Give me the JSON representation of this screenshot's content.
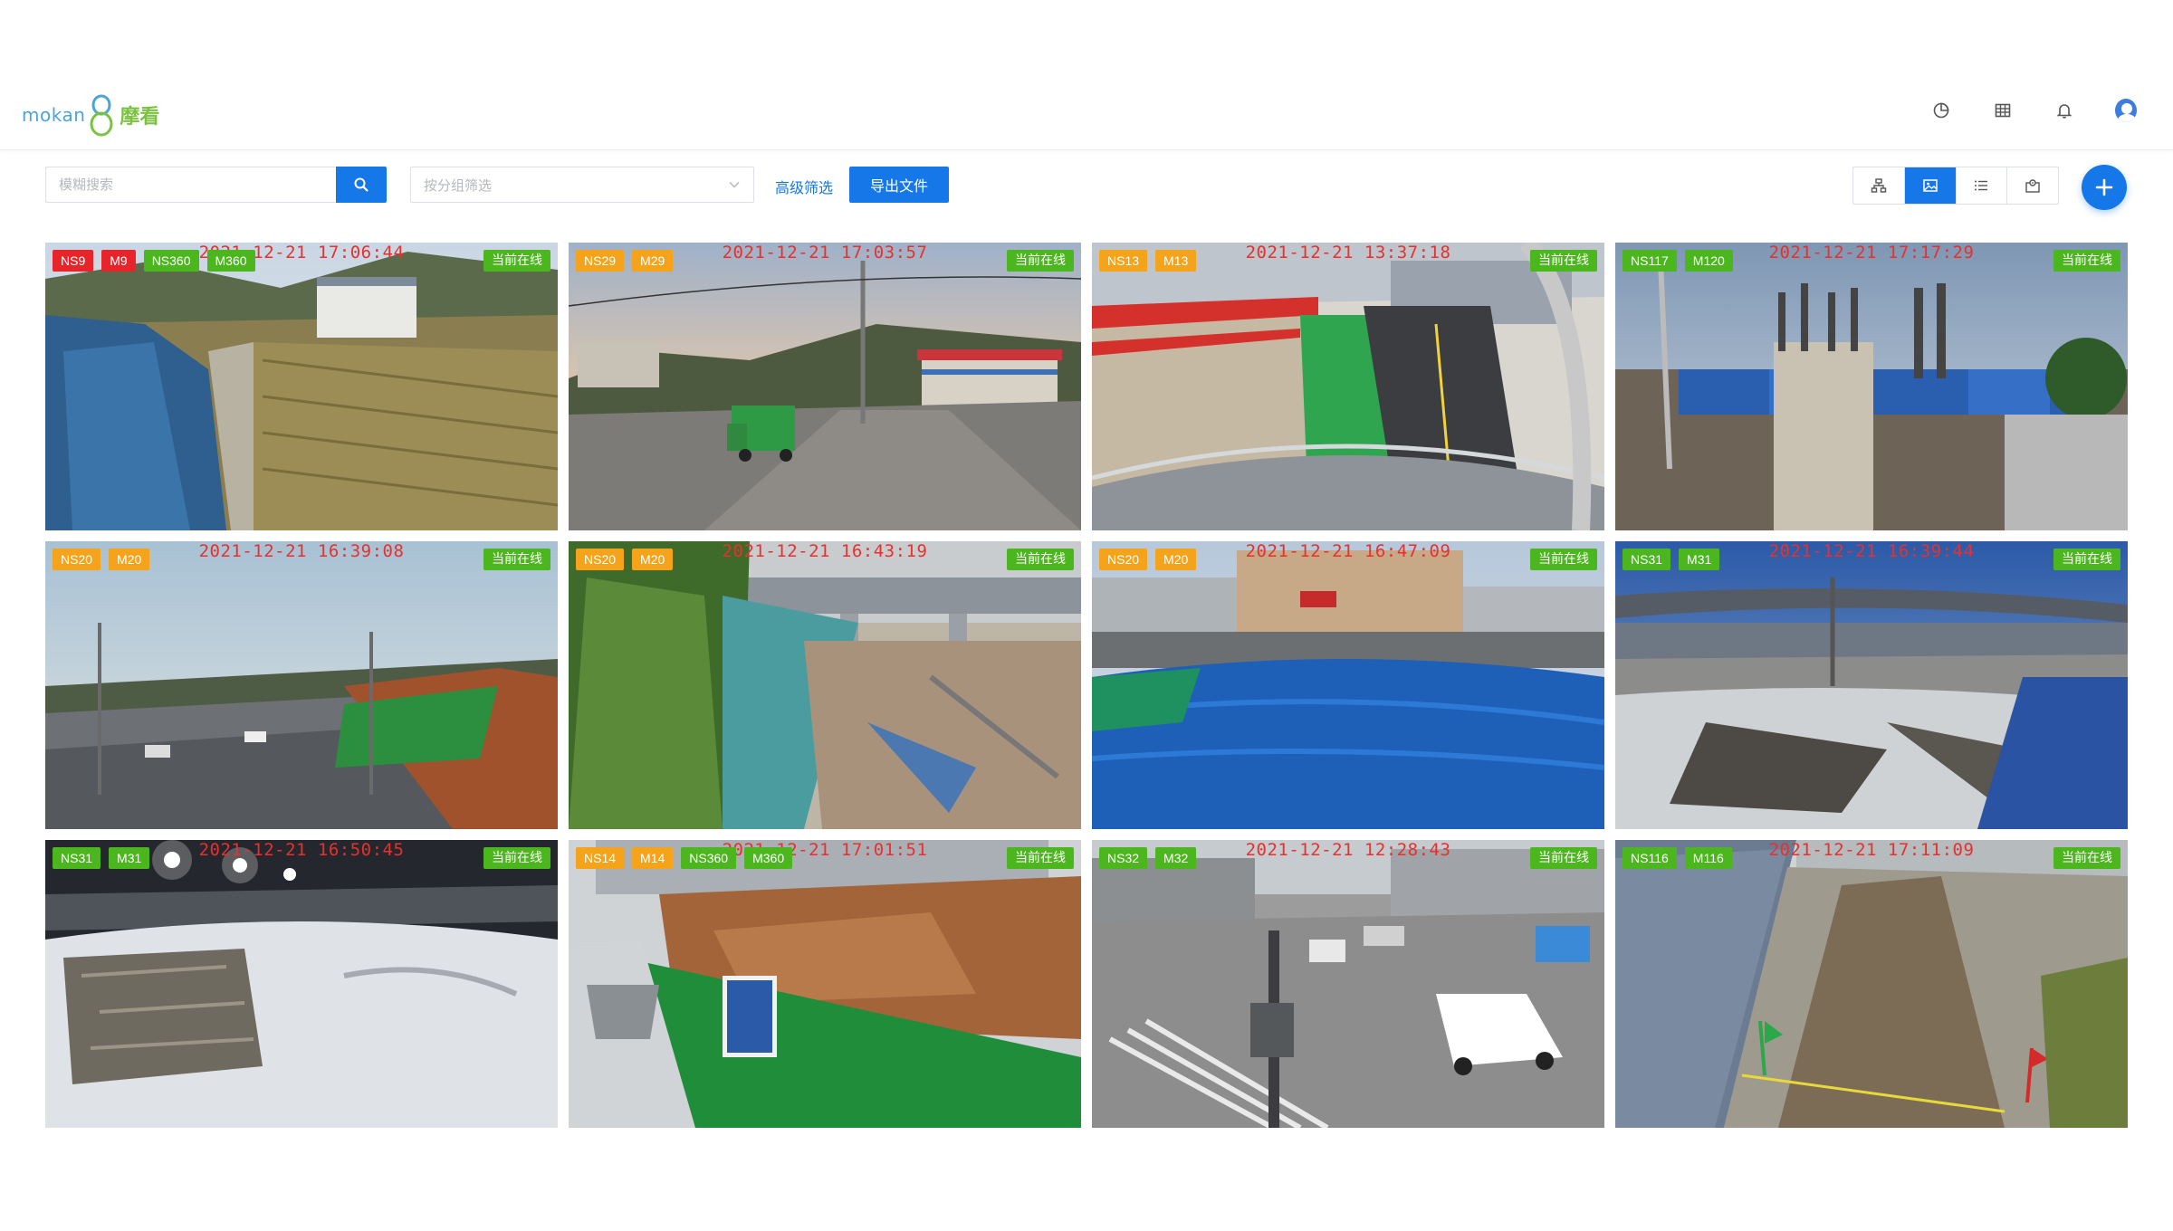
{
  "app": {
    "logo_text": "mokan",
    "logo_cn": "摩看"
  },
  "toolbar": {
    "search_placeholder": "模糊搜索",
    "group_placeholder": "按分组筛选",
    "advanced_filter": "高级筛选",
    "export_label": "导出文件"
  },
  "top_icons": [
    "chart-icon",
    "grid-icon",
    "bell-icon",
    "user-avatar"
  ],
  "view_modes": [
    "org-view-icon",
    "image-view-icon",
    "list-view-icon",
    "map-view-icon"
  ],
  "active_view": "image-view-icon",
  "colors": {
    "primary": "#1677e8",
    "tag_red": "#e8242b",
    "tag_orange": "#f4a31a",
    "tag_green": "#4cb61f",
    "stamp": "#e8302c"
  },
  "cameras": [
    {
      "tags": [
        {
          "text": "NS9",
          "color": "red"
        },
        {
          "text": "M9",
          "color": "red"
        },
        {
          "text": "NS360",
          "color": "green"
        },
        {
          "text": "M360",
          "color": "green"
        }
      ],
      "status": "当前在线",
      "timestamp": "2021-12-21 17:06:44",
      "scene": "river"
    },
    {
      "tags": [
        {
          "text": "NS29",
          "color": "orange"
        },
        {
          "text": "M29",
          "color": "orange"
        }
      ],
      "status": "当前在线",
      "timestamp": "2021-12-21 17:03:57",
      "scene": "road-truck"
    },
    {
      "tags": [
        {
          "text": "NS13",
          "color": "orange"
        },
        {
          "text": "M13",
          "color": "orange"
        }
      ],
      "status": "当前在线",
      "timestamp": "2021-12-21 13:37:18",
      "scene": "construction-red"
    },
    {
      "tags": [
        {
          "text": "NS117",
          "color": "green"
        },
        {
          "text": "M120",
          "color": "green"
        }
      ],
      "status": "当前在线",
      "timestamp": "2021-12-21 17:17:29",
      "scene": "pillar"
    },
    {
      "tags": [
        {
          "text": "NS20",
          "color": "orange"
        },
        {
          "text": "M20",
          "color": "orange"
        }
      ],
      "status": "当前在线",
      "timestamp": "2021-12-21 16:39:08",
      "scene": "highway"
    },
    {
      "tags": [
        {
          "text": "NS20",
          "color": "orange"
        },
        {
          "text": "M20",
          "color": "orange"
        }
      ],
      "status": "当前在线",
      "timestamp": "2021-12-21 16:43:19",
      "scene": "bridge-site"
    },
    {
      "tags": [
        {
          "text": "NS20",
          "color": "orange"
        },
        {
          "text": "M20",
          "color": "orange"
        }
      ],
      "status": "当前在线",
      "timestamp": "2021-12-21 16:47:09",
      "scene": "blue-tarp"
    },
    {
      "tags": [
        {
          "text": "NS31",
          "color": "green"
        },
        {
          "text": "M31",
          "color": "green"
        }
      ],
      "status": "当前在线",
      "timestamp": "2021-12-21 16:39:44",
      "scene": "overpass-night"
    },
    {
      "tags": [
        {
          "text": "NS31",
          "color": "green"
        },
        {
          "text": "M31",
          "color": "green"
        }
      ],
      "status": "当前在线",
      "timestamp": "2021-12-21 16:50:45",
      "scene": "snow-night"
    },
    {
      "tags": [
        {
          "text": "NS14",
          "color": "orange"
        },
        {
          "text": "M14",
          "color": "orange"
        },
        {
          "text": "NS360",
          "color": "green"
        },
        {
          "text": "M360",
          "color": "green"
        }
      ],
      "status": "当前在线",
      "timestamp": "2021-12-21 17:01:51",
      "scene": "dirt-fence"
    },
    {
      "tags": [
        {
          "text": "NS32",
          "color": "green"
        },
        {
          "text": "M32",
          "color": "green"
        }
      ],
      "status": "当前在线",
      "timestamp": "2021-12-21 12:28:43",
      "scene": "intersection"
    },
    {
      "tags": [
        {
          "text": "NS116",
          "color": "green"
        },
        {
          "text": "M116",
          "color": "green"
        }
      ],
      "status": "当前在线",
      "timestamp": "2021-12-21 17:11:09",
      "scene": "trench"
    }
  ]
}
